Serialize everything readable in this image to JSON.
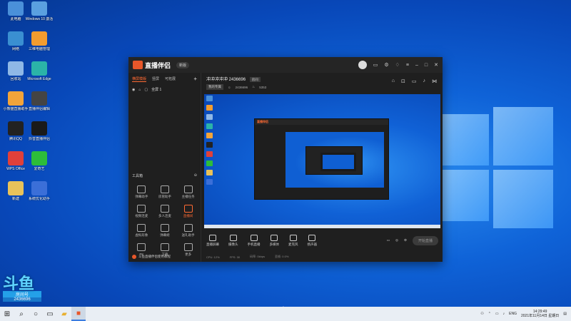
{
  "desktop": {
    "icons": [
      {
        "name": "此电脑",
        "color": "#4a90d9"
      },
      {
        "name": "Windows 10 激活",
        "color": "#5aa0e0"
      },
      {
        "name": "网络",
        "color": "#3a8fd1"
      },
      {
        "name": "三维电脑管理",
        "color": "#f39c2e"
      },
      {
        "name": "回收站",
        "color": "#8fb8e6"
      },
      {
        "name": "Microsoft Edge",
        "color": "#2bb3a8"
      },
      {
        "name": "小熊猫直播助手",
        "color": "#f2a43a"
      },
      {
        "name": "直播伴侣编辑",
        "color": "#444444"
      },
      {
        "name": "腾讯QQ",
        "color": "#222222"
      },
      {
        "name": "抖音直播伴侣",
        "color": "#1a1a1a"
      },
      {
        "name": "WPS Office",
        "color": "#e0403a"
      },
      {
        "name": "爱奇艺",
        "color": "#2dbd3a"
      },
      {
        "name": "新建",
        "color": "#e8c25a"
      },
      {
        "name": "系统优化助手",
        "color": "#3b6fd8"
      }
    ],
    "promo": {
      "big": "斗鱼",
      "tag": "房间号",
      "num": "2436696"
    }
  },
  "app": {
    "logo": "直播伴侣",
    "version": "新版",
    "sidebar": {
      "tabs": [
        "横屏模版",
        "竖屏",
        "可拓展"
      ],
      "plus": "+",
      "scene": "全屏 1",
      "tools_title": "工具箱",
      "tools": [
        {
          "label": "弹幕助手",
          "hl": false
        },
        {
          "label": "房管助手",
          "hl": false
        },
        {
          "label": "主播任务",
          "hl": false
        },
        {
          "label": "视频连麦",
          "hl": false
        },
        {
          "label": "多人连麦",
          "hl": false
        },
        {
          "label": "直播间",
          "hl": true
        },
        {
          "label": "虚拟形象",
          "hl": false
        },
        {
          "label": "弹幕姬",
          "hl": false
        },
        {
          "label": "送礼助手",
          "hl": false
        },
        {
          "label": "PK",
          "hl": false
        },
        {
          "label": "下载",
          "hl": false
        },
        {
          "label": "更多",
          "hl": false
        }
      ],
      "notice": "斗鱼直播伴侣使用教程"
    },
    "room": {
      "name": "冲冲冲冲冲 2436696",
      "badge": "房间",
      "category": "我的专属",
      "followers": "2436696",
      "hot": "5353"
    },
    "controls": [
      {
        "label": "直播屏幕"
      },
      {
        "label": "摄像头"
      },
      {
        "label": "手机直播"
      },
      {
        "label": "多媒体"
      },
      {
        "label": "麦克风"
      },
      {
        "label": "扬声器"
      }
    ],
    "live_button": "开始直播",
    "status": [
      "CPU: 12%",
      "FPS: 30",
      "码率: 0kbps",
      "丢帧: 0.0%"
    ]
  },
  "taskbar": {
    "clock_time": "14:29:49",
    "clock_date": "2021年11月14日 星期日",
    "ime": "ENG"
  }
}
